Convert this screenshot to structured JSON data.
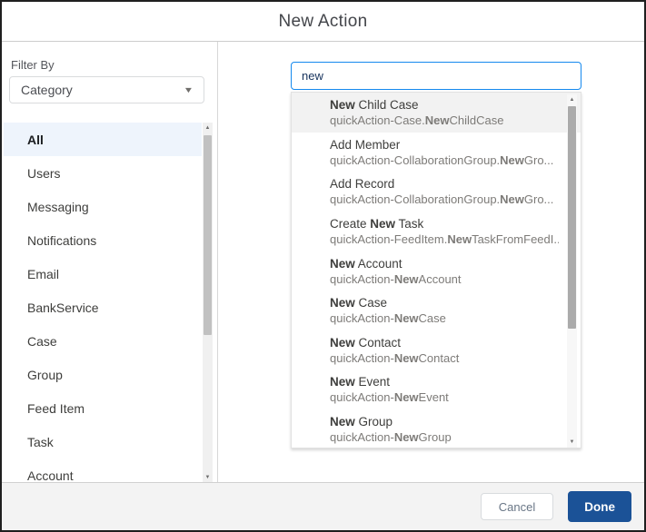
{
  "modal": {
    "title": "New Action"
  },
  "filter": {
    "label": "Filter By",
    "dropdown_value": "Category"
  },
  "categories": {
    "selected": "All",
    "items": [
      "All",
      "Users",
      "Messaging",
      "Notifications",
      "Email",
      "BankService",
      "Case",
      "Group",
      "Feed Item",
      "Task",
      "Account"
    ]
  },
  "search": {
    "value": "new"
  },
  "results": [
    {
      "highlighted": true,
      "title": [
        {
          "text": "New",
          "bold": true
        },
        {
          "text": " Child Case",
          "bold": false
        }
      ],
      "subtitle": [
        {
          "text": "quickAction-Case.",
          "bold": false
        },
        {
          "text": "New",
          "bold": true
        },
        {
          "text": "ChildCase",
          "bold": false
        }
      ]
    },
    {
      "highlighted": false,
      "title": [
        {
          "text": "Add Member",
          "bold": false
        }
      ],
      "subtitle": [
        {
          "text": "quickAction-CollaborationGroup.",
          "bold": false
        },
        {
          "text": "New",
          "bold": true
        },
        {
          "text": "Gro...",
          "bold": false
        }
      ]
    },
    {
      "highlighted": false,
      "title": [
        {
          "text": "Add Record",
          "bold": false
        }
      ],
      "subtitle": [
        {
          "text": "quickAction-CollaborationGroup.",
          "bold": false
        },
        {
          "text": "New",
          "bold": true
        },
        {
          "text": "Gro...",
          "bold": false
        }
      ]
    },
    {
      "highlighted": false,
      "title": [
        {
          "text": "Create ",
          "bold": false
        },
        {
          "text": "New",
          "bold": true
        },
        {
          "text": " Task",
          "bold": false
        }
      ],
      "subtitle": [
        {
          "text": "quickAction-FeedItem.",
          "bold": false
        },
        {
          "text": "New",
          "bold": true
        },
        {
          "text": "TaskFromFeedI...",
          "bold": false
        }
      ]
    },
    {
      "highlighted": false,
      "title": [
        {
          "text": "New",
          "bold": true
        },
        {
          "text": " Account",
          "bold": false
        }
      ],
      "subtitle": [
        {
          "text": "quickAction-",
          "bold": false
        },
        {
          "text": "New",
          "bold": true
        },
        {
          "text": "Account",
          "bold": false
        }
      ]
    },
    {
      "highlighted": false,
      "title": [
        {
          "text": "New",
          "bold": true
        },
        {
          "text": " Case",
          "bold": false
        }
      ],
      "subtitle": [
        {
          "text": "quickAction-",
          "bold": false
        },
        {
          "text": "New",
          "bold": true
        },
        {
          "text": "Case",
          "bold": false
        }
      ]
    },
    {
      "highlighted": false,
      "title": [
        {
          "text": "New",
          "bold": true
        },
        {
          "text": " Contact",
          "bold": false
        }
      ],
      "subtitle": [
        {
          "text": "quickAction-",
          "bold": false
        },
        {
          "text": "New",
          "bold": true
        },
        {
          "text": "Contact",
          "bold": false
        }
      ]
    },
    {
      "highlighted": false,
      "title": [
        {
          "text": "New",
          "bold": true
        },
        {
          "text": " Event",
          "bold": false
        }
      ],
      "subtitle": [
        {
          "text": "quickAction-",
          "bold": false
        },
        {
          "text": "New",
          "bold": true
        },
        {
          "text": "Event",
          "bold": false
        }
      ]
    },
    {
      "highlighted": false,
      "title": [
        {
          "text": "New",
          "bold": true
        },
        {
          "text": " Group",
          "bold": false
        }
      ],
      "subtitle": [
        {
          "text": "quickAction-",
          "bold": false
        },
        {
          "text": "New",
          "bold": true
        },
        {
          "text": "Group",
          "bold": false
        }
      ]
    }
  ],
  "footer": {
    "cancel_label": "Cancel",
    "done_label": "Done"
  },
  "colors": {
    "focus_border_blue": "#1589ee",
    "done_button_bg": "#1b5297",
    "selected_category_bg": "#eef4fc",
    "highlighted_result_bg": "#f2f2f2"
  }
}
